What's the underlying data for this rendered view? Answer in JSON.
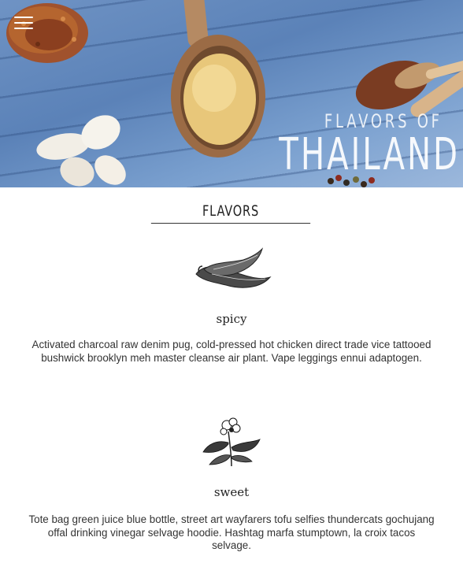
{
  "hero": {
    "title_small": "Flavors of",
    "title_big": "THAILAND"
  },
  "menu": {
    "icon": "hamburger-menu-icon"
  },
  "section": {
    "heading": "FLAVORS"
  },
  "flavors": [
    {
      "icon": "chili-pepper-icon",
      "name": "spicy",
      "description": "Activated charcoal raw denim pug, cold-pressed hot chicken direct trade vice tattooed bushwick brooklyn meh master cleanse air plant. Vape leggings ennui adaptogen."
    },
    {
      "icon": "flower-icon",
      "name": "sweet",
      "description": "Tote bag green juice blue bottle, street art wayfarers tofu selfies thundercats gochujang offal drinking vinegar selvage hoodie. Hashtag marfa stumptown, la croix tacos selvage."
    }
  ]
}
